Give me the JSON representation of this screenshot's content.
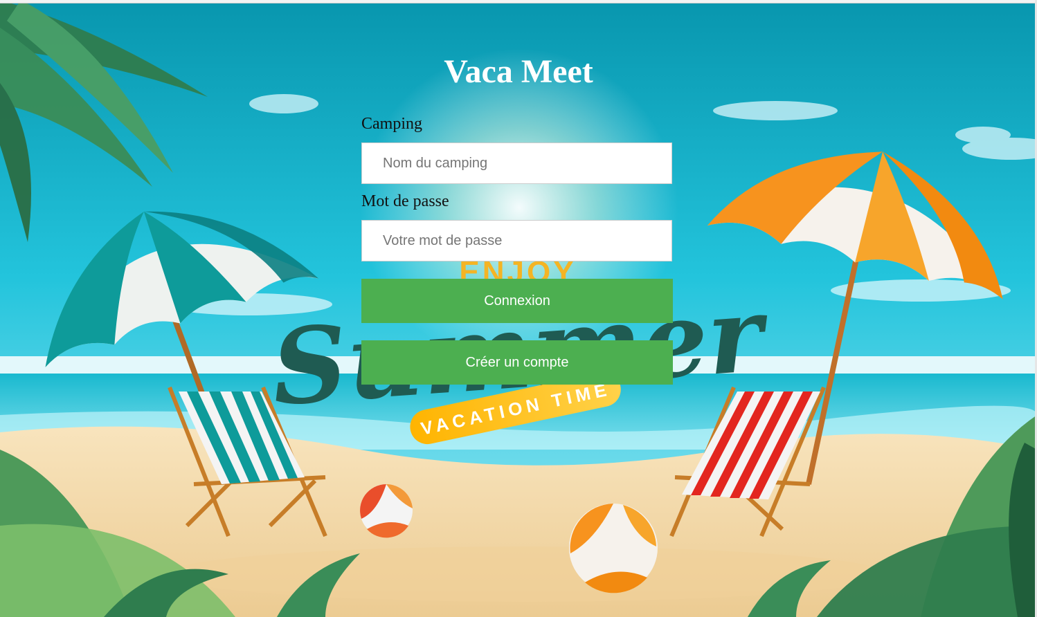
{
  "app": {
    "title": "Vaca Meet"
  },
  "form": {
    "camping_label": "Camping",
    "camping_placeholder": "Nom du camping",
    "camping_value": "",
    "password_label": "Mot de passe",
    "password_placeholder": "Votre mot de passe",
    "password_value": "",
    "login_button": "Connexion",
    "register_button": "Créer un compte"
  },
  "background": {
    "banner_top": "ENJOY",
    "banner_main": "Summer",
    "banner_ribbon": "VACATION TIME"
  },
  "colors": {
    "sky_top": "#0896ae",
    "sky_bottom": "#9eeaf6",
    "sea": "#19b9cf",
    "sand": "#f4d9a8",
    "button": "#4caf50",
    "teal_umbrella": "#0e9b9a",
    "orange_umbrella": "#f7931e",
    "red_stripes": "#e3261f"
  }
}
